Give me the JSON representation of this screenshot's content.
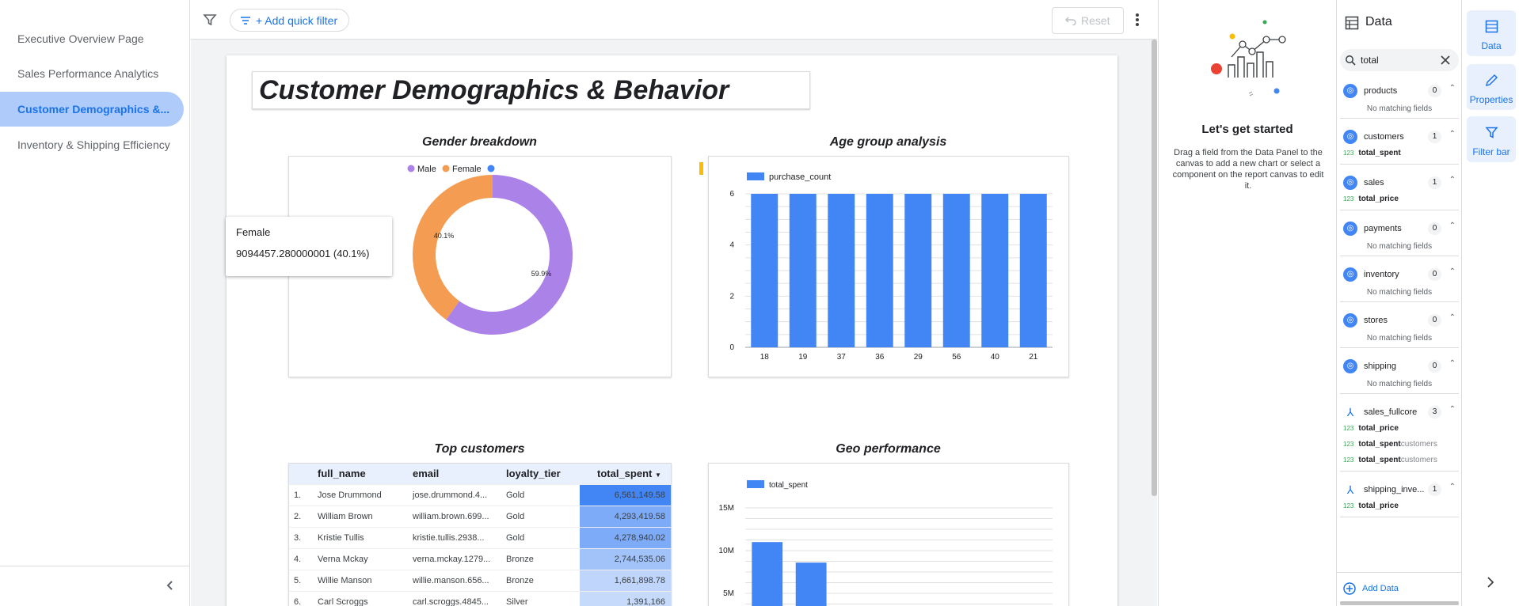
{
  "nav": {
    "pages": [
      {
        "label": "Executive Overview Page"
      },
      {
        "label": "Sales Performance Analytics"
      },
      {
        "label": "Customer Demographics &..."
      },
      {
        "label": "Inventory & Shipping Efficiency"
      }
    ],
    "collapse_icon": "chevron-left-icon"
  },
  "toolbar": {
    "add_filter_label": "+ Add quick filter",
    "reset_label": "Reset"
  },
  "report": {
    "title": "Customer Demographics & Behavior",
    "gender_title": "Gender breakdown",
    "age_title": "Age group analysis",
    "top_customers_title": "Top customers",
    "geo_title": "Geo performance"
  },
  "tooltip": {
    "label": "Female",
    "value": "9094457.280000001 (40.1%)"
  },
  "chart_data": [
    {
      "type": "pie",
      "title": "Gender breakdown",
      "legend": [
        "Male",
        "Female",
        ""
      ],
      "categories": [
        "Male",
        "Female"
      ],
      "values": [
        59.9,
        40.1
      ],
      "labels": [
        "59.9%",
        "40.1%"
      ],
      "colors": [
        "#ab82e8",
        "#f49d52"
      ],
      "legend_colors": [
        "#ab82e8",
        "#f49d52",
        "#4285f4"
      ],
      "legend_placement": "top"
    },
    {
      "type": "bar",
      "title": "Age group analysis",
      "series": [
        {
          "name": "purchase_count",
          "values": [
            6,
            6,
            6,
            6,
            6,
            6,
            6,
            6
          ]
        }
      ],
      "categories": [
        "18",
        "19",
        "37",
        "36",
        "29",
        "56",
        "40",
        "21"
      ],
      "yticks": [
        "0",
        "2",
        "4",
        "6"
      ],
      "ylim": [
        0,
        6
      ],
      "color": "#4285f4",
      "grid": true
    },
    {
      "type": "bar",
      "title": "Geo performance",
      "series": [
        {
          "name": "total_spent",
          "values": [
            11000000,
            8600000
          ]
        }
      ],
      "yticks": [
        "5M",
        "10M",
        "15M"
      ],
      "ylim": [
        0,
        15000000
      ],
      "color": "#4285f4",
      "grid": true
    }
  ],
  "table": {
    "headers": [
      "full_name",
      "email",
      "loyalty_tier",
      "total_spent"
    ],
    "rows": [
      {
        "idx": "1.",
        "name": "Jose Drummond",
        "email": "jose.drummond.4...",
        "tier": "Gold",
        "spent": "6,561,149.58",
        "level": 1.0
      },
      {
        "idx": "2.",
        "name": "William Brown",
        "email": "william.brown.699...",
        "tier": "Gold",
        "spent": "4,293,419.58",
        "level": 0.65
      },
      {
        "idx": "3.",
        "name": "Kristie Tullis",
        "email": "kristie.tullis.2938...",
        "tier": "Gold",
        "spent": "4,278,940.02",
        "level": 0.65
      },
      {
        "idx": "4.",
        "name": "Verna Mckay",
        "email": "verna.mckay.1279...",
        "tier": "Bronze",
        "spent": "2,744,535.06",
        "level": 0.42
      },
      {
        "idx": "5.",
        "name": "Willie Manson",
        "email": "willie.manson.656...",
        "tier": "Bronze",
        "spent": "1,661,898.78",
        "level": 0.25
      },
      {
        "idx": "6.",
        "name": "Carl Scroggs",
        "email": "carl.scroggs.4845...",
        "tier": "Silver",
        "spent": "1,391,166",
        "level": 0.21
      }
    ]
  },
  "empty_panel": {
    "heading": "Let's get started",
    "body": "Drag a field from the Data Panel to the canvas to add a new chart or select a component on the report canvas to edit it."
  },
  "data_panel": {
    "title": "Data",
    "search_value": "total",
    "no_match": "No matching fields",
    "sources": [
      {
        "name": "products",
        "count": "0",
        "fields": []
      },
      {
        "name": "customers",
        "count": "1",
        "fields": [
          {
            "name": "total_spent",
            "sub": ""
          }
        ]
      },
      {
        "name": "sales",
        "count": "1",
        "fields": [
          {
            "name": "total_price",
            "sub": ""
          }
        ]
      },
      {
        "name": "payments",
        "count": "0",
        "fields": []
      },
      {
        "name": "inventory",
        "count": "0",
        "fields": []
      },
      {
        "name": "stores",
        "count": "0",
        "fields": []
      },
      {
        "name": "shipping",
        "count": "0",
        "fields": []
      },
      {
        "name": "sales_fullcore",
        "count": "3",
        "blend": true,
        "fields": [
          {
            "name": "total_price",
            "sub": ""
          },
          {
            "name": "total_spent",
            "sub": "customers"
          },
          {
            "name": "total_spent",
            "sub": "customers"
          }
        ]
      },
      {
        "name": "shipping_inve...",
        "count": "1",
        "blend": true,
        "fields": [
          {
            "name": "total_price",
            "sub": ""
          }
        ]
      }
    ],
    "field_type": "123",
    "add_data_label": "Add Data"
  },
  "side_tabs": [
    {
      "label": "Data",
      "icon": "table-icon"
    },
    {
      "label": "Properties",
      "icon": "pencil-icon"
    },
    {
      "label": "Filter bar",
      "icon": "filter-icon"
    }
  ]
}
